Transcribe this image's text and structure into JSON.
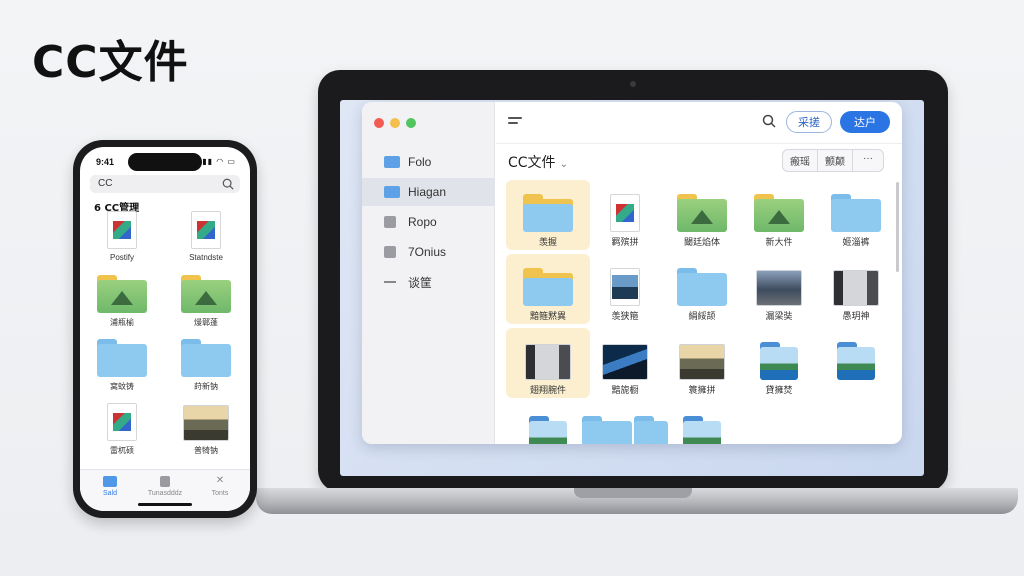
{
  "page": {
    "title": "CC文件"
  },
  "laptop": {
    "sidebar": {
      "items": [
        {
          "label": "Folo",
          "icon": "folder-icon"
        },
        {
          "label": "Hiagan",
          "icon": "folder-icon"
        },
        {
          "label": "Ropo",
          "icon": "document-icon"
        },
        {
          "label": "7Onius",
          "icon": "document-icon"
        },
        {
          "label": "谈筐",
          "icon": "dash-icon"
        }
      ]
    },
    "toolbar": {
      "button_outline": "采搓",
      "button_primary": "达户"
    },
    "folder_title": "CC文件",
    "segments": [
      "瘢瑶",
      "颤颠",
      "···"
    ],
    "grid": [
      {
        "label": "羡握",
        "kind": "folder-yellow",
        "highlighted": true
      },
      {
        "label": "羁殡拼",
        "kind": "doc"
      },
      {
        "label": "閾廷焰体",
        "kind": "folder-green"
      },
      {
        "label": "新大件",
        "kind": "folder-green"
      },
      {
        "label": "姬淄裤",
        "kind": "folder"
      },
      {
        "label": "黯箍黙異",
        "kind": "folder-yellow",
        "highlighted": true
      },
      {
        "label": "羡狭箍",
        "kind": "docphoto"
      },
      {
        "label": "絹綏颉",
        "kind": "folder"
      },
      {
        "label": "漏梁奘",
        "kind": "photo"
      },
      {
        "label": "愚玥神",
        "kind": "photo-street"
      },
      {
        "label": "翅翔腕件",
        "kind": "photo-street",
        "highlighted": true
      },
      {
        "label": "黯旎橱",
        "kind": "photo-dark"
      },
      {
        "label": "簑擁拼",
        "kind": "photo-sunset"
      },
      {
        "label": "貸擁焚",
        "kind": "photo-fold"
      },
      {
        "label": "",
        "kind": "photo-fold"
      },
      {
        "label": "",
        "kind": "photo-fold"
      },
      {
        "label": "",
        "kind": "folder-double"
      },
      {
        "label": "",
        "kind": "photo-fold"
      }
    ]
  },
  "phone": {
    "time": "9:41",
    "search_text": "CC",
    "heading": "6 CC管理",
    "grid": [
      {
        "label": "Postify",
        "kind": "doc"
      },
      {
        "label": "Statndste",
        "kind": "doc"
      },
      {
        "label": "浦瓶榆",
        "kind": "folder-green"
      },
      {
        "label": "熳鄣蓬",
        "kind": "folder-green"
      },
      {
        "label": "窝蚊铸",
        "kind": "folder"
      },
      {
        "label": "莳新钠",
        "kind": "folder"
      },
      {
        "label": "雷杌硕",
        "kind": "doc"
      },
      {
        "label": "普犄钠",
        "kind": "photo-sunset"
      }
    ],
    "tabs": [
      {
        "label": "Sald",
        "active": true
      },
      {
        "label": "Tunasdddz",
        "active": false
      },
      {
        "label": "Tonts",
        "active": false
      }
    ]
  },
  "colors": {
    "accent": "#2b74e4",
    "folder": "#8ec9f0",
    "highlight": "#fbefcf"
  }
}
